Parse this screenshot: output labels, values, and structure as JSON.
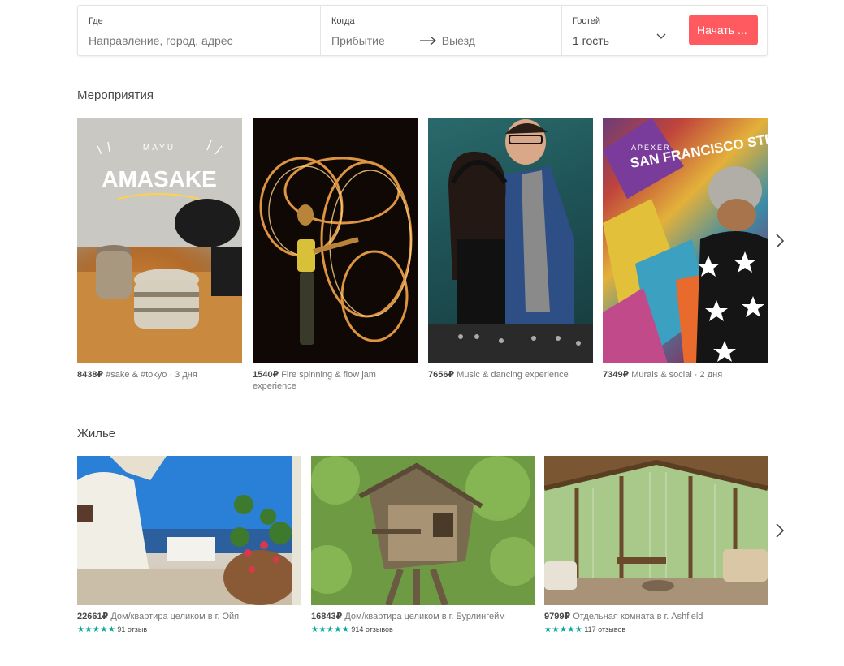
{
  "search": {
    "where_label": "Где",
    "where_placeholder": "Направление, город, адрес",
    "when_label": "Когда",
    "checkin": "Прибытие",
    "checkout": "Выезд",
    "guests_label": "Гостей",
    "guests_value": "1 гость",
    "start_button": "Начать ..."
  },
  "experiences": {
    "title": "Мероприятия",
    "items": [
      {
        "price": "8438₽",
        "text": "#sake & #tokyo · 3 дня",
        "image": "amasake",
        "image_text_top": "MAYU",
        "image_text_main": "AMASAKE"
      },
      {
        "price": "1540₽",
        "text": "Fire spinning & flow jam experience",
        "image": "fire"
      },
      {
        "price": "7656₽",
        "text": "Music & dancing experience",
        "image": "dj"
      },
      {
        "price": "7349₽",
        "text": "Murals & social · 2 дня",
        "image": "sf",
        "image_text_top": "APEXER",
        "image_text_main": "SAN FRANCISCO STREETS"
      }
    ]
  },
  "homes": {
    "title": "Жилье",
    "items": [
      {
        "price": "22661₽",
        "text": "Дом/квартира целиком в г. Ойя",
        "stars": "★★★★★",
        "reviews": "91 отзыв",
        "image": "oia"
      },
      {
        "price": "16843₽",
        "text": "Дом/квартира целиком в г. Бурлингейм",
        "stars": "★★★★★",
        "reviews": "914 отзывов",
        "image": "treehouse"
      },
      {
        "price": "9799₽",
        "text": "Отдельная комната в г. Ashfield",
        "stars": "★★★★★",
        "reviews": "117 отзывов",
        "image": "room"
      }
    ]
  },
  "colors": {
    "accent": "#ff5a5f",
    "stars": "#00a699"
  },
  "icons": {
    "checkin_arrow": "arrow-right-icon",
    "guests_dropdown": "chevron-down-icon",
    "carousel_next": "chevron-right-icon"
  }
}
